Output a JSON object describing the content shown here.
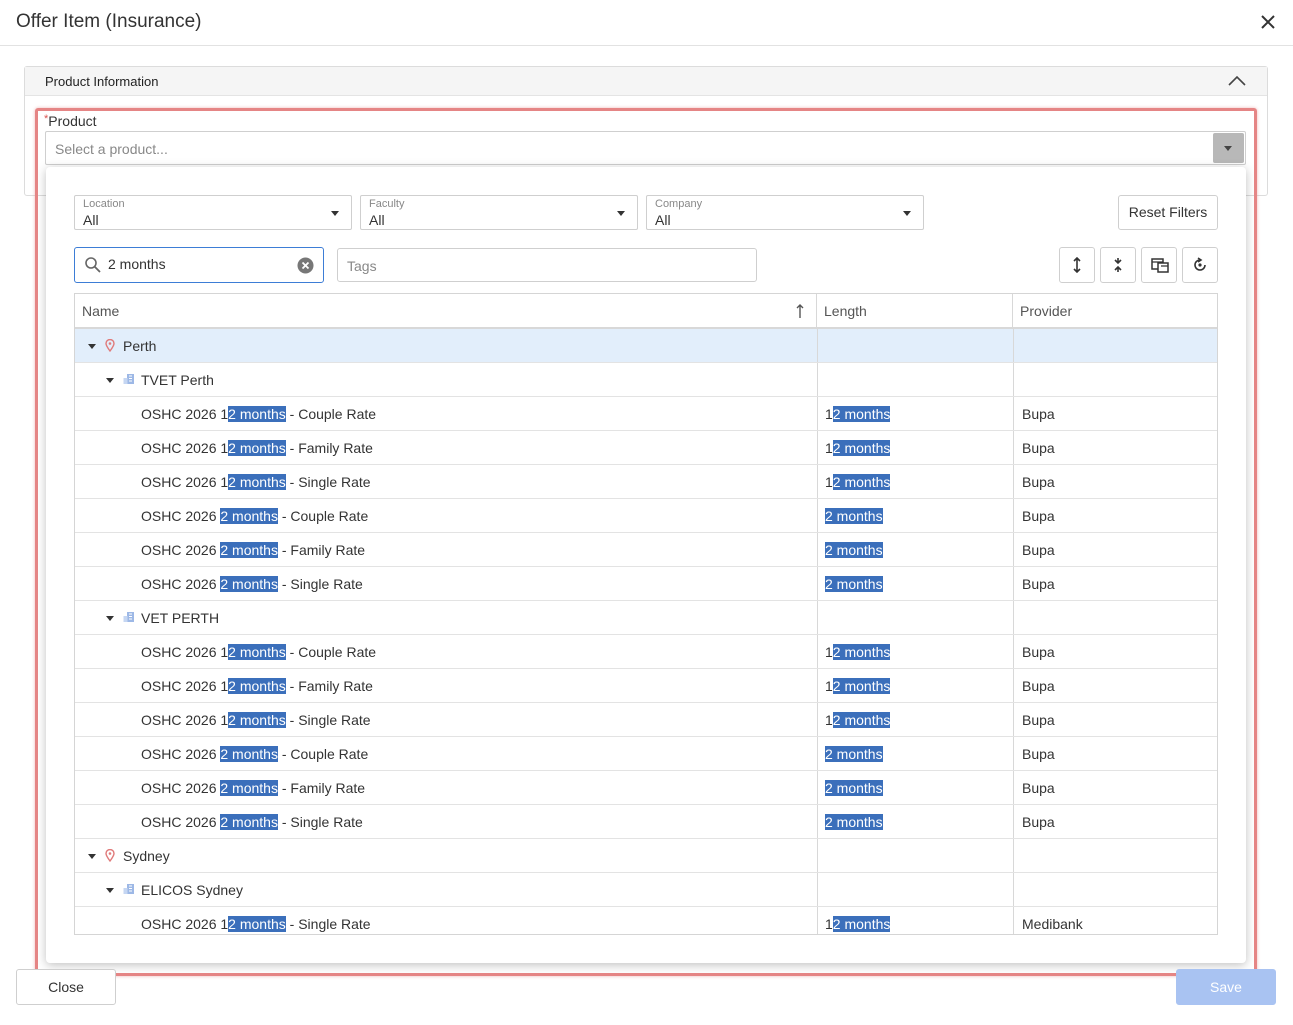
{
  "dialog": {
    "title": "Offer Item (Insurance)"
  },
  "section": {
    "title": "Product Information"
  },
  "product": {
    "label": "Product",
    "required_mark": "*",
    "placeholder": "Select a product..."
  },
  "filters": [
    {
      "label": "Location",
      "value": "All"
    },
    {
      "label": "Faculty",
      "value": "All"
    },
    {
      "label": "Company",
      "value": "All"
    }
  ],
  "reset_label": "Reset Filters",
  "search": {
    "value": "2 months"
  },
  "tags": {
    "placeholder": "Tags"
  },
  "toolbar_icons": [
    "expand-all-icon",
    "collapse-all-icon",
    "column-chooser-icon",
    "refresh-icon"
  ],
  "grid": {
    "columns": [
      "Name",
      "Length",
      "Provider"
    ],
    "highlight": "2 months",
    "highlight_color": "#3b6fbb",
    "rows": [
      {
        "type": "group",
        "level": 0,
        "label": "Perth",
        "selected": true
      },
      {
        "type": "group",
        "level": 1,
        "label": "TVET Perth"
      },
      {
        "type": "item",
        "pre": "OSHC 2026 1",
        "hl": "2 months",
        "post": " - Couple Rate",
        "len_pre": "1",
        "len_hl": "2 months",
        "provider": "Bupa"
      },
      {
        "type": "item",
        "pre": "OSHC 2026 1",
        "hl": "2 months",
        "post": " - Family Rate",
        "len_pre": "1",
        "len_hl": "2 months",
        "provider": "Bupa"
      },
      {
        "type": "item",
        "pre": "OSHC 2026 1",
        "hl": "2 months",
        "post": " - Single Rate",
        "len_pre": "1",
        "len_hl": "2 months",
        "provider": "Bupa"
      },
      {
        "type": "item",
        "pre": "OSHC 2026 ",
        "hl": "2 months",
        "post": " - Couple Rate",
        "len_pre": "",
        "len_hl": "2 months",
        "provider": "Bupa"
      },
      {
        "type": "item",
        "pre": "OSHC 2026 ",
        "hl": "2 months",
        "post": " - Family Rate",
        "len_pre": "",
        "len_hl": "2 months",
        "provider": "Bupa"
      },
      {
        "type": "item",
        "pre": "OSHC 2026 ",
        "hl": "2 months",
        "post": " - Single Rate",
        "len_pre": "",
        "len_hl": "2 months",
        "provider": "Bupa"
      },
      {
        "type": "group",
        "level": 1,
        "label": "VET PERTH"
      },
      {
        "type": "item",
        "pre": "OSHC 2026 1",
        "hl": "2 months",
        "post": " - Couple Rate",
        "len_pre": "1",
        "len_hl": "2 months",
        "provider": "Bupa"
      },
      {
        "type": "item",
        "pre": "OSHC 2026 1",
        "hl": "2 months",
        "post": " - Family Rate",
        "len_pre": "1",
        "len_hl": "2 months",
        "provider": "Bupa"
      },
      {
        "type": "item",
        "pre": "OSHC 2026 1",
        "hl": "2 months",
        "post": " - Single Rate",
        "len_pre": "1",
        "len_hl": "2 months",
        "provider": "Bupa"
      },
      {
        "type": "item",
        "pre": "OSHC 2026 ",
        "hl": "2 months",
        "post": " - Couple Rate",
        "len_pre": "",
        "len_hl": "2 months",
        "provider": "Bupa"
      },
      {
        "type": "item",
        "pre": "OSHC 2026 ",
        "hl": "2 months",
        "post": " - Family Rate",
        "len_pre": "",
        "len_hl": "2 months",
        "provider": "Bupa"
      },
      {
        "type": "item",
        "pre": "OSHC 2026 ",
        "hl": "2 months",
        "post": " - Single Rate",
        "len_pre": "",
        "len_hl": "2 months",
        "provider": "Bupa"
      },
      {
        "type": "group",
        "level": 0,
        "label": "Sydney"
      },
      {
        "type": "group",
        "level": 1,
        "label": "ELICOS Sydney"
      },
      {
        "type": "item",
        "pre": "OSHC 2026 1",
        "hl": "2 months",
        "post": " - Single Rate",
        "len_pre": "1",
        "len_hl": "2 months",
        "provider": "Medibank"
      }
    ]
  },
  "footer": {
    "close_label": "Close",
    "save_label": "Save"
  },
  "colors": {
    "accent": "#3d7dd6",
    "highlight_frame": "#e58585",
    "save_disabled": "#a9c3f2",
    "selected_row": "#e2eefb"
  }
}
